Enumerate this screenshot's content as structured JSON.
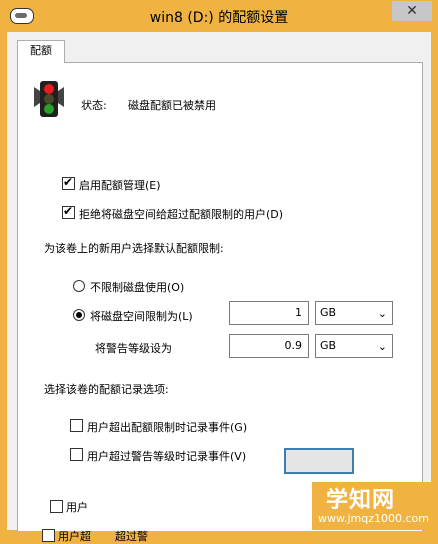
{
  "window": {
    "title": "win8 (D:) 的配额设置",
    "close_glyph": "✕"
  },
  "tabs": [
    {
      "label": "配额"
    }
  ],
  "status": {
    "label": "状态:",
    "value": "磁盘配额已被禁用"
  },
  "options": {
    "enable_quota": {
      "label": "启用配额管理(E)",
      "checked": true
    },
    "deny_space": {
      "label": "拒绝将磁盘空间给超过配额限制的用户(D)",
      "checked": true
    }
  },
  "default_limit": {
    "heading": "为该卷上的新用户选择默认配额限制:",
    "no_limit": {
      "label": "不限制磁盘使用(O)",
      "selected": false
    },
    "limit_to": {
      "label": "将磁盘空间限制为(L)",
      "selected": true,
      "value": "1",
      "unit": "GB"
    },
    "warning": {
      "label": "将警告等级设为",
      "value": "0.9",
      "unit": "GB"
    }
  },
  "logging": {
    "heading": "选择该卷的配额记录选项:",
    "over_limit": {
      "label": "用户超出配额限制时记录事件(G)",
      "checked": false
    },
    "over_warning": {
      "label": "用户超过警告等级时记录事件(V)",
      "checked": false
    }
  },
  "partial": {
    "row1": "用户",
    "row2_a": "用户超",
    "row2_b": "超过警"
  },
  "watermark": {
    "main": "学知网",
    "url": "www.jmqz1000.com"
  },
  "icons": {
    "drive": "drive-icon",
    "traffic_light": "traffic-light-icon",
    "dropdown": "chevron-down-icon",
    "close": "close-icon"
  },
  "colors": {
    "title_bar": "#f0b341",
    "dialog_bg": "#f0f0f0",
    "panel_bg": "#ffffff"
  }
}
